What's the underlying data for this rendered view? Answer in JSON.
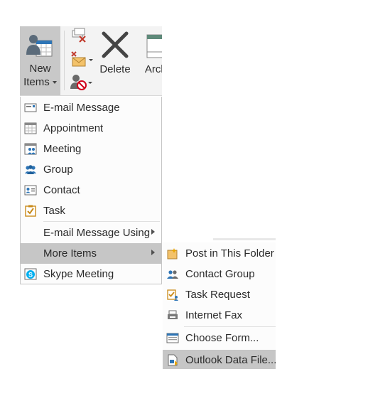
{
  "ribbon": {
    "new_items": {
      "line1": "New",
      "line2": "Items",
      "icon": "new-items-icon"
    },
    "delete": {
      "label": "Delete",
      "icon": "delete-x-icon"
    },
    "archive": {
      "label": "Archi",
      "icon": "archive-icon"
    },
    "small_icons": [
      "ignore-icon",
      "clean-up-icon",
      "junk-icon"
    ]
  },
  "menu": {
    "items": [
      {
        "label": "E-mail Message",
        "icon": "email-message-icon"
      },
      {
        "label": "Appointment",
        "icon": "appointment-icon"
      },
      {
        "label": "Meeting",
        "icon": "meeting-icon"
      },
      {
        "label": "Group",
        "icon": "group-icon"
      },
      {
        "label": "Contact",
        "icon": "contact-icon"
      },
      {
        "label": "Task",
        "icon": "task-icon"
      },
      {
        "label": "E-mail Message Using",
        "has_submenu": true
      },
      {
        "label": "More Items",
        "has_submenu": true,
        "highlighted": true
      },
      {
        "label": "Skype Meeting",
        "icon": "skype-meeting-icon"
      }
    ]
  },
  "submenu": {
    "items": [
      {
        "label": "Post in This Folder",
        "icon": "post-icon"
      },
      {
        "label": "Contact Group",
        "icon": "contact-group-icon"
      },
      {
        "label": "Task Request",
        "icon": "task-request-icon"
      },
      {
        "label": "Internet Fax",
        "icon": "fax-icon"
      },
      {
        "label": "Choose Form...",
        "icon": "form-icon"
      },
      {
        "label": "Outlook Data File...",
        "icon": "data-file-icon",
        "highlighted": true
      }
    ]
  },
  "colors": {
    "highlight": "#c6c6c6",
    "ribbon_bg": "#f3f3f3",
    "accent_blue": "#2e75b6"
  }
}
